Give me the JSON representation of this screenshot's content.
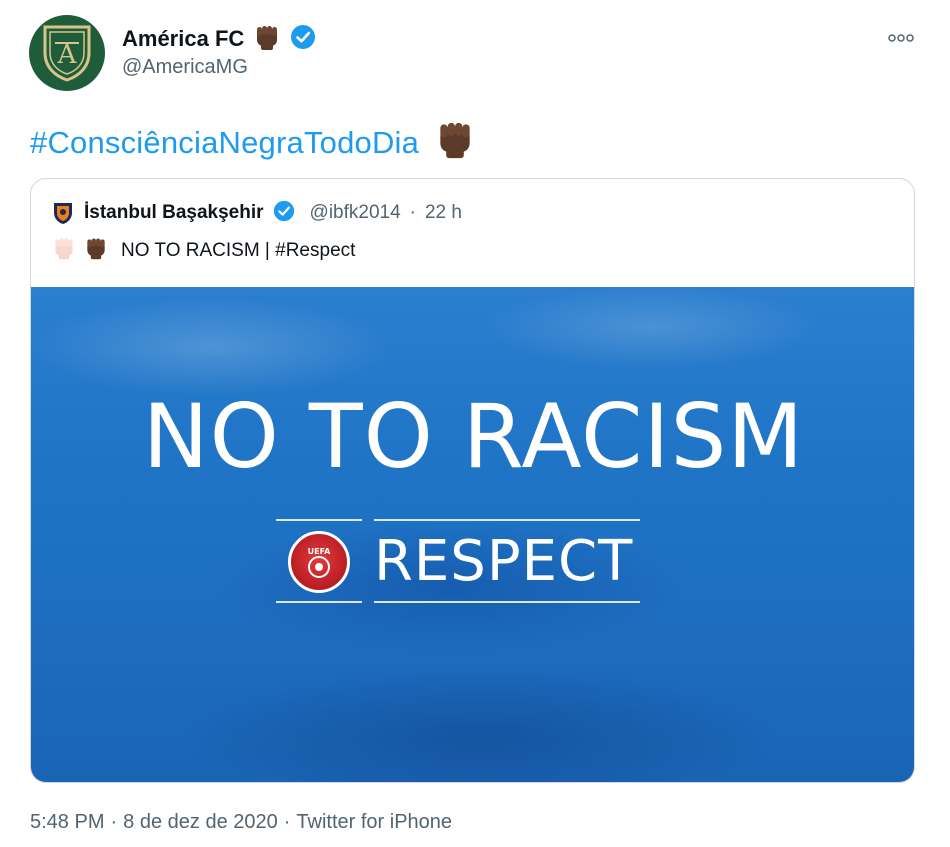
{
  "author": {
    "name": "América FC",
    "handle": "@AmericaMG",
    "verified": true,
    "name_emoji": "raised-fist-dark-skin",
    "avatar_icon": "america-fc-crest",
    "avatar_color": "#1f5c3a"
  },
  "tweet": {
    "hashtag": "#ConsciênciaNegraTodoDia",
    "emoji": "raised-fist-dark-skin",
    "link_color": "#1d9bf0"
  },
  "quoted": {
    "name": "İstanbul Başakşehir",
    "handle": "@ibfk2014",
    "separator": "·",
    "time": "22 h",
    "verified": true,
    "text": "NO TO RACISM | #Respect",
    "emojis": [
      "raised-fist-light-skin",
      "raised-fist-dark-skin"
    ],
    "media": {
      "headline": "NO TO RACISM",
      "respect": "RESPECT",
      "badge_text": "UEFA",
      "background_color": "#1f74c6"
    }
  },
  "footer": {
    "time": "5:48 PM",
    "date": "8 de dez de 2020",
    "source": "Twitter for iPhone",
    "separator": "·"
  },
  "colors": {
    "verified": "#1d9bf0",
    "secondary_text": "#536471",
    "border": "#cfd9de"
  }
}
